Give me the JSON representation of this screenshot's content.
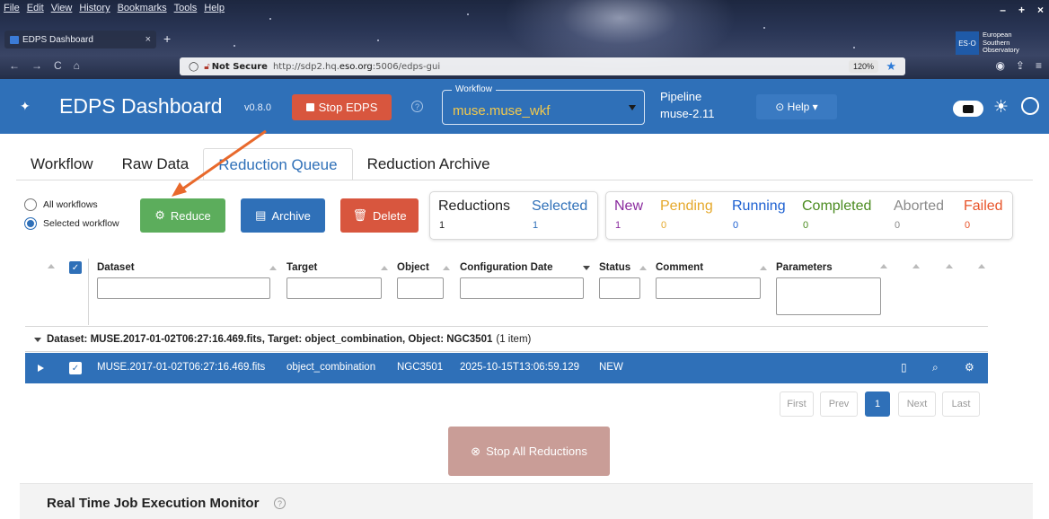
{
  "browser": {
    "menu": [
      "File",
      "Edit",
      "View",
      "History",
      "Bookmarks",
      "Tools",
      "Help"
    ],
    "tab_title": "EDPS Dashboard",
    "tab_close": "×",
    "new_tab": "+",
    "url_secure_label": "Not Secure",
    "url_prefix": "http://sdp2.hq.",
    "url_domain": "eso.org",
    "url_suffix": ":5006/edps-gui",
    "zoom": "120%",
    "window_controls": [
      "–",
      "+",
      "×"
    ],
    "eso_logo_box": "ES\nO",
    "eso_logo_lines": [
      "European",
      "Southern",
      "Observatory"
    ]
  },
  "header": {
    "title": "EDPS Dashboard",
    "version": "v0.8.0",
    "stop_label": "Stop EDPS",
    "workflow_legend": "Workflow",
    "workflow_value": "muse.muse_wkf",
    "pipeline_label": "Pipeline",
    "pipeline_value": "muse-2.11",
    "help_label": "⊙ Help ▾"
  },
  "tabs": [
    "Workflow",
    "Raw Data",
    "Reduction Queue",
    "Reduction Archive"
  ],
  "active_tab": "Reduction Queue",
  "scope": {
    "options": [
      "All workflows",
      "Selected workflow"
    ],
    "selected": "Selected workflow"
  },
  "actions": {
    "reduce": "Reduce",
    "archive": "Archive",
    "delete": "Delete"
  },
  "counts": {
    "reductions": {
      "label": "Reductions",
      "value": "1"
    },
    "selected": {
      "label": "Selected",
      "value": "1"
    },
    "new": {
      "label": "New",
      "value": "1"
    },
    "pending": {
      "label": "Pending",
      "value": "0"
    },
    "running": {
      "label": "Running",
      "value": "0"
    },
    "completed": {
      "label": "Completed",
      "value": "0"
    },
    "aborted": {
      "label": "Aborted",
      "value": "0"
    },
    "failed": {
      "label": "Failed",
      "value": "0"
    }
  },
  "colors": {
    "new": "#8a2a9e",
    "pending": "#e5a82a",
    "running": "#1b5fd1",
    "completed": "#4a8b1f",
    "aborted": "#8a8a8a",
    "failed": "#e8542a",
    "selected": "#2f70b8"
  },
  "table": {
    "columns": [
      "Dataset",
      "Target",
      "Object",
      "Configuration Date",
      "Status",
      "Comment",
      "Parameters"
    ],
    "group": {
      "label": "Dataset: MUSE.2017-01-02T06:27:16.469.fits, Target: object_combination, Object: NGC3501",
      "count": "(1 item)"
    },
    "rows": [
      {
        "dataset": "MUSE.2017-01-02T06:27:16.469.fits",
        "target": "object_combination",
        "object": "NGC3501",
        "config_date": "2025-10-15T13:06:59.129",
        "status": "NEW"
      }
    ]
  },
  "pagination": {
    "first": "First",
    "prev": "Prev",
    "page": "1",
    "next": "Next",
    "last": "Last"
  },
  "stop_all": "Stop All Reductions",
  "monitor_title": "Real Time Job Execution Monitor"
}
